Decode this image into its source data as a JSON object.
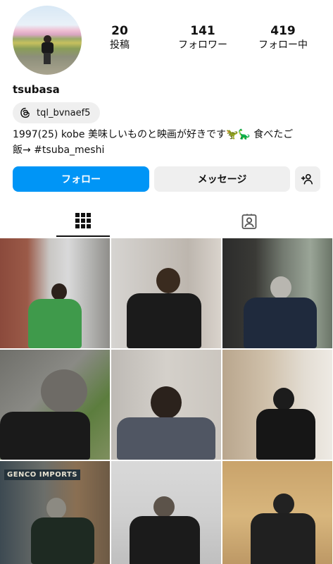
{
  "profile": {
    "username": "tsubasa",
    "threads_handle": "tql_bvnaef5",
    "bio_line1": "1997(25) kobe 美味しいものと映画が好きです🦖🦕 食べたご",
    "bio_line2": "飯→ #tsuba_meshi"
  },
  "stats": [
    {
      "value": "20",
      "label": "投稿"
    },
    {
      "value": "141",
      "label": "フォロワー"
    },
    {
      "value": "419",
      "label": "フォロー中"
    }
  ],
  "actions": {
    "follow_label": "フォロー",
    "message_label": "メッセージ",
    "add_user_icon": "person-add-icon"
  },
  "tabs": [
    {
      "name": "grid",
      "icon": "grid-icon",
      "active": true
    },
    {
      "name": "tagged",
      "icon": "tagged-person-icon",
      "active": false
    }
  ],
  "post_signs": {
    "genco": "GENCO IMPORTS"
  },
  "colors": {
    "accent": "#0095f6",
    "button_gray": "#efefef"
  }
}
